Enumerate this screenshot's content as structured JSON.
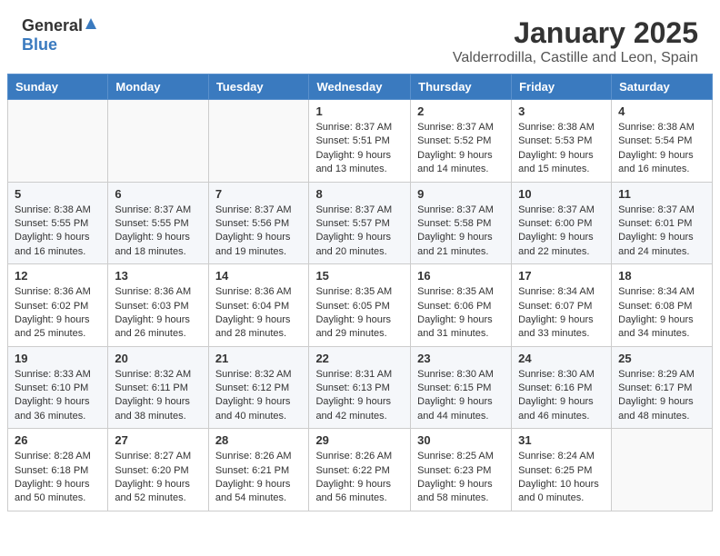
{
  "header": {
    "logo_general": "General",
    "logo_blue": "Blue",
    "title": "January 2025",
    "subtitle": "Valderrodilla, Castille and Leon, Spain"
  },
  "weekdays": [
    "Sunday",
    "Monday",
    "Tuesday",
    "Wednesday",
    "Thursday",
    "Friday",
    "Saturday"
  ],
  "weeks": [
    [
      {
        "day": "",
        "info": ""
      },
      {
        "day": "",
        "info": ""
      },
      {
        "day": "",
        "info": ""
      },
      {
        "day": "1",
        "info": "Sunrise: 8:37 AM\nSunset: 5:51 PM\nDaylight: 9 hours\nand 13 minutes."
      },
      {
        "day": "2",
        "info": "Sunrise: 8:37 AM\nSunset: 5:52 PM\nDaylight: 9 hours\nand 14 minutes."
      },
      {
        "day": "3",
        "info": "Sunrise: 8:38 AM\nSunset: 5:53 PM\nDaylight: 9 hours\nand 15 minutes."
      },
      {
        "day": "4",
        "info": "Sunrise: 8:38 AM\nSunset: 5:54 PM\nDaylight: 9 hours\nand 16 minutes."
      }
    ],
    [
      {
        "day": "5",
        "info": "Sunrise: 8:38 AM\nSunset: 5:55 PM\nDaylight: 9 hours\nand 16 minutes."
      },
      {
        "day": "6",
        "info": "Sunrise: 8:37 AM\nSunset: 5:55 PM\nDaylight: 9 hours\nand 18 minutes."
      },
      {
        "day": "7",
        "info": "Sunrise: 8:37 AM\nSunset: 5:56 PM\nDaylight: 9 hours\nand 19 minutes."
      },
      {
        "day": "8",
        "info": "Sunrise: 8:37 AM\nSunset: 5:57 PM\nDaylight: 9 hours\nand 20 minutes."
      },
      {
        "day": "9",
        "info": "Sunrise: 8:37 AM\nSunset: 5:58 PM\nDaylight: 9 hours\nand 21 minutes."
      },
      {
        "day": "10",
        "info": "Sunrise: 8:37 AM\nSunset: 6:00 PM\nDaylight: 9 hours\nand 22 minutes."
      },
      {
        "day": "11",
        "info": "Sunrise: 8:37 AM\nSunset: 6:01 PM\nDaylight: 9 hours\nand 24 minutes."
      }
    ],
    [
      {
        "day": "12",
        "info": "Sunrise: 8:36 AM\nSunset: 6:02 PM\nDaylight: 9 hours\nand 25 minutes."
      },
      {
        "day": "13",
        "info": "Sunrise: 8:36 AM\nSunset: 6:03 PM\nDaylight: 9 hours\nand 26 minutes."
      },
      {
        "day": "14",
        "info": "Sunrise: 8:36 AM\nSunset: 6:04 PM\nDaylight: 9 hours\nand 28 minutes."
      },
      {
        "day": "15",
        "info": "Sunrise: 8:35 AM\nSunset: 6:05 PM\nDaylight: 9 hours\nand 29 minutes."
      },
      {
        "day": "16",
        "info": "Sunrise: 8:35 AM\nSunset: 6:06 PM\nDaylight: 9 hours\nand 31 minutes."
      },
      {
        "day": "17",
        "info": "Sunrise: 8:34 AM\nSunset: 6:07 PM\nDaylight: 9 hours\nand 33 minutes."
      },
      {
        "day": "18",
        "info": "Sunrise: 8:34 AM\nSunset: 6:08 PM\nDaylight: 9 hours\nand 34 minutes."
      }
    ],
    [
      {
        "day": "19",
        "info": "Sunrise: 8:33 AM\nSunset: 6:10 PM\nDaylight: 9 hours\nand 36 minutes."
      },
      {
        "day": "20",
        "info": "Sunrise: 8:32 AM\nSunset: 6:11 PM\nDaylight: 9 hours\nand 38 minutes."
      },
      {
        "day": "21",
        "info": "Sunrise: 8:32 AM\nSunset: 6:12 PM\nDaylight: 9 hours\nand 40 minutes."
      },
      {
        "day": "22",
        "info": "Sunrise: 8:31 AM\nSunset: 6:13 PM\nDaylight: 9 hours\nand 42 minutes."
      },
      {
        "day": "23",
        "info": "Sunrise: 8:30 AM\nSunset: 6:15 PM\nDaylight: 9 hours\nand 44 minutes."
      },
      {
        "day": "24",
        "info": "Sunrise: 8:30 AM\nSunset: 6:16 PM\nDaylight: 9 hours\nand 46 minutes."
      },
      {
        "day": "25",
        "info": "Sunrise: 8:29 AM\nSunset: 6:17 PM\nDaylight: 9 hours\nand 48 minutes."
      }
    ],
    [
      {
        "day": "26",
        "info": "Sunrise: 8:28 AM\nSunset: 6:18 PM\nDaylight: 9 hours\nand 50 minutes."
      },
      {
        "day": "27",
        "info": "Sunrise: 8:27 AM\nSunset: 6:20 PM\nDaylight: 9 hours\nand 52 minutes."
      },
      {
        "day": "28",
        "info": "Sunrise: 8:26 AM\nSunset: 6:21 PM\nDaylight: 9 hours\nand 54 minutes."
      },
      {
        "day": "29",
        "info": "Sunrise: 8:26 AM\nSunset: 6:22 PM\nDaylight: 9 hours\nand 56 minutes."
      },
      {
        "day": "30",
        "info": "Sunrise: 8:25 AM\nSunset: 6:23 PM\nDaylight: 9 hours\nand 58 minutes."
      },
      {
        "day": "31",
        "info": "Sunrise: 8:24 AM\nSunset: 6:25 PM\nDaylight: 10 hours\nand 0 minutes."
      },
      {
        "day": "",
        "info": ""
      }
    ]
  ]
}
